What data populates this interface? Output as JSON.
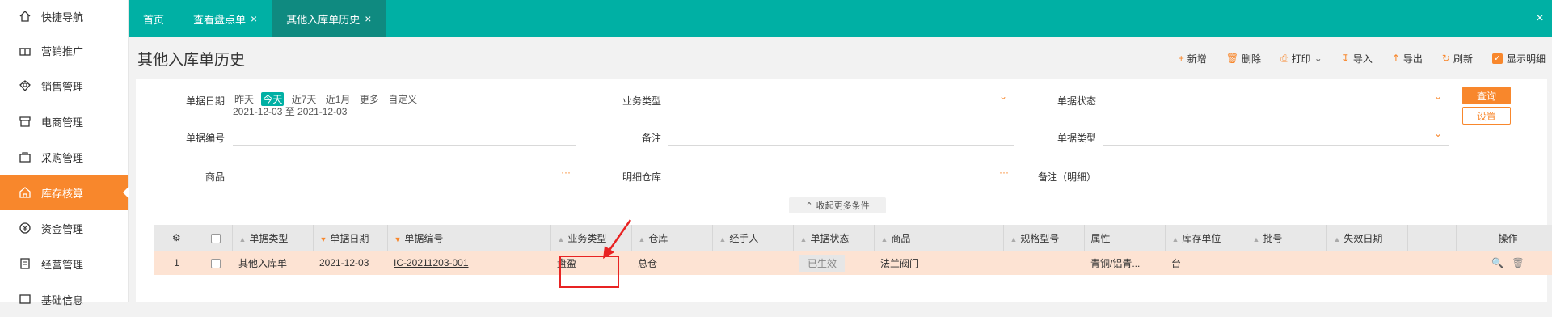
{
  "sidebar": {
    "items": [
      {
        "label": "快捷导航",
        "icon": "home-icon"
      },
      {
        "label": "营销推广",
        "icon": "gift-icon"
      },
      {
        "label": "销售管理",
        "icon": "sales-icon"
      },
      {
        "label": "电商管理",
        "icon": "store-icon"
      },
      {
        "label": "采购管理",
        "icon": "bag-icon"
      },
      {
        "label": "库存核算",
        "icon": "warehouse-icon",
        "active": true
      },
      {
        "label": "资金管理",
        "icon": "money-icon"
      },
      {
        "label": "经营管理",
        "icon": "report-icon"
      },
      {
        "label": "基础信息",
        "icon": "info-icon"
      }
    ]
  },
  "tabs": [
    {
      "label": "首页"
    },
    {
      "label": "查看盘点单",
      "close": "×"
    },
    {
      "label": "其他入库单历史",
      "close": "×",
      "active": true
    }
  ],
  "close_all": "×",
  "page_title": "其他入库单历史",
  "toolbar": {
    "add": "新增",
    "delete": "删除",
    "print": "打印",
    "import": "导入",
    "export": "导出",
    "refresh": "刷新",
    "show_detail": "显示明细"
  },
  "filters": {
    "date_label": "单据日期",
    "date_options": [
      "昨天",
      "今天",
      "近7天",
      "近1月",
      "更多",
      "自定义"
    ],
    "date_range": "2021-12-03 至 2021-12-03",
    "biz_type_label": "业务类型",
    "doc_status_label": "单据状态",
    "doc_no_label": "单据编号",
    "remark_label": "备注",
    "doc_type_label": "单据类型",
    "product_label": "商品",
    "detail_wh_label": "明细仓库",
    "detail_remark_label": "备注（明细）",
    "ellipsis": "···",
    "query_button": "查询",
    "settings_button": "设置",
    "collapse": "收起更多条件"
  },
  "table": {
    "columns": [
      "单据类型",
      "单据日期",
      "单据编号",
      "业务类型",
      "仓库",
      "经手人",
      "单据状态",
      "商品",
      "规格型号",
      "属性",
      "库存单位",
      "批号",
      "失效日期",
      "操作"
    ],
    "rows": [
      {
        "index": "1",
        "doc_type": "其他入库单",
        "date": "2021-12-03",
        "doc_no": "IC-20211203-001",
        "biz_type": "盘盈",
        "warehouse": "总仓",
        "handler": "",
        "status": "已生效",
        "product": "法兰阀门",
        "spec": "",
        "attr": "青铜/铝青...",
        "unit": "台",
        "batch": "",
        "expiry": ""
      }
    ]
  },
  "colors": {
    "accent": "#00b0a4",
    "orange": "#f8872c",
    "highlight": "#e82323"
  }
}
